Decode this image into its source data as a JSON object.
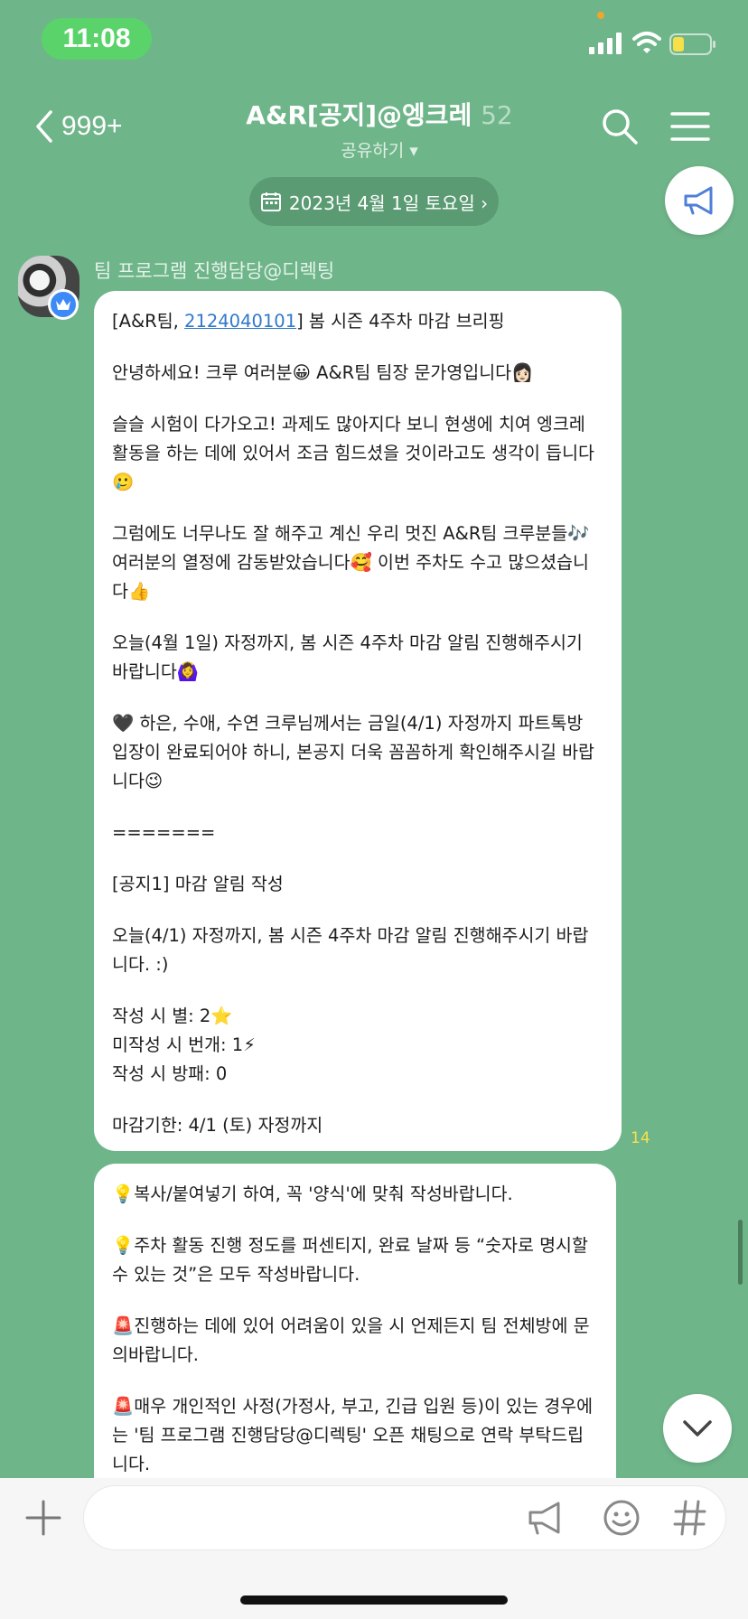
{
  "status_bar": {
    "time": "11:08"
  },
  "header": {
    "back_count": "999+",
    "title": "A&R[공지]@엥크레",
    "member_count": "52",
    "subtitle": "공유하기 ▾"
  },
  "date_divider": "2023년 4월 1일 토요일 ›",
  "sender": {
    "name": "팀 프로그램 진행담당@디렉팅"
  },
  "message1": {
    "l1_pre": "[A&R팀, ",
    "l1_link": "2124040101",
    "l1_post": "] 봄 시즌 4주차 마감 브리핑",
    "l2": "안녕하세요! 크루 여러분😀 A&R팀 팀장 문가영입니다👩🏻",
    "l3": "슬슬 시험이 다가오고! 과제도 많아지다 보니 현생에 치여 엥크레 활동을 하는 데에 있어서 조금 힘드셨을 것이라고도 생각이 듭니다🥲",
    "l4": "그럼에도 너무나도 잘 해주고 계신 우리 멋진 A&R팀 크루분들🎶 여러분의 열정에 감동받았습니다🥰 이번 주차도 수고 많으셨습니다👍",
    "l5": "오늘(4월 1일) 자정까지, 봄 시즌 4주차 마감 알림 진행해주시기 바랍니다🙆‍♀️",
    "l6": "🖤 하은, 수애, 수연 크루님께서는 금일(4/1) 자정까지 파트톡방 입장이 완료되어야 하니, 본공지 더욱 꼼꼼하게 확인해주시길 바랍니다😉",
    "l7": "=======",
    "l8": "[공지1] 마감 알림 작성",
    "l9": "오늘(4/1) 자정까지, 봄 시즌 4주차 마감 알림 진행해주시기 바랍니다. :)",
    "l10": "작성 시 별: 2⭐",
    "l11": "미작성 시 번개: 1⚡",
    "l12": "작성 시 방패: 0",
    "l13": "마감기한: 4/1 (토) 자정까지",
    "read_count": "14"
  },
  "message2": {
    "l1": "💡복사/붙여넣기 하여, 꼭 '양식'에 맞춰 작성바랍니다.",
    "l2": "💡주차 활동 진행 정도를 퍼센티지, 완료 날짜 등 “숫자로 명시할 수 있는 것”은 모두 작성바랍니다.",
    "l3": "🚨진행하는 데에 있어 어려움이 있을 시 언제든지 팀 전체방에 문의바랍니다.",
    "l4": "🚨매우 개인적인 사정(가정사, 부고, 긴급 입원 등)이 있는 경우에는 '팀 프로그램 진행담당@디렉팅' 오픈 채팅으로 연락 부탁드립니다."
  },
  "icons": [
    "calendar-icon",
    "megaphone-icon",
    "search-icon",
    "menu-icon",
    "chevron-down-icon",
    "plus-icon",
    "emoji-icon",
    "hashtag-icon"
  ],
  "colors": {
    "background": "#6fb58a",
    "bubble": "#ffffff",
    "link": "#2f79c9",
    "read_count": "#f6e04c"
  }
}
